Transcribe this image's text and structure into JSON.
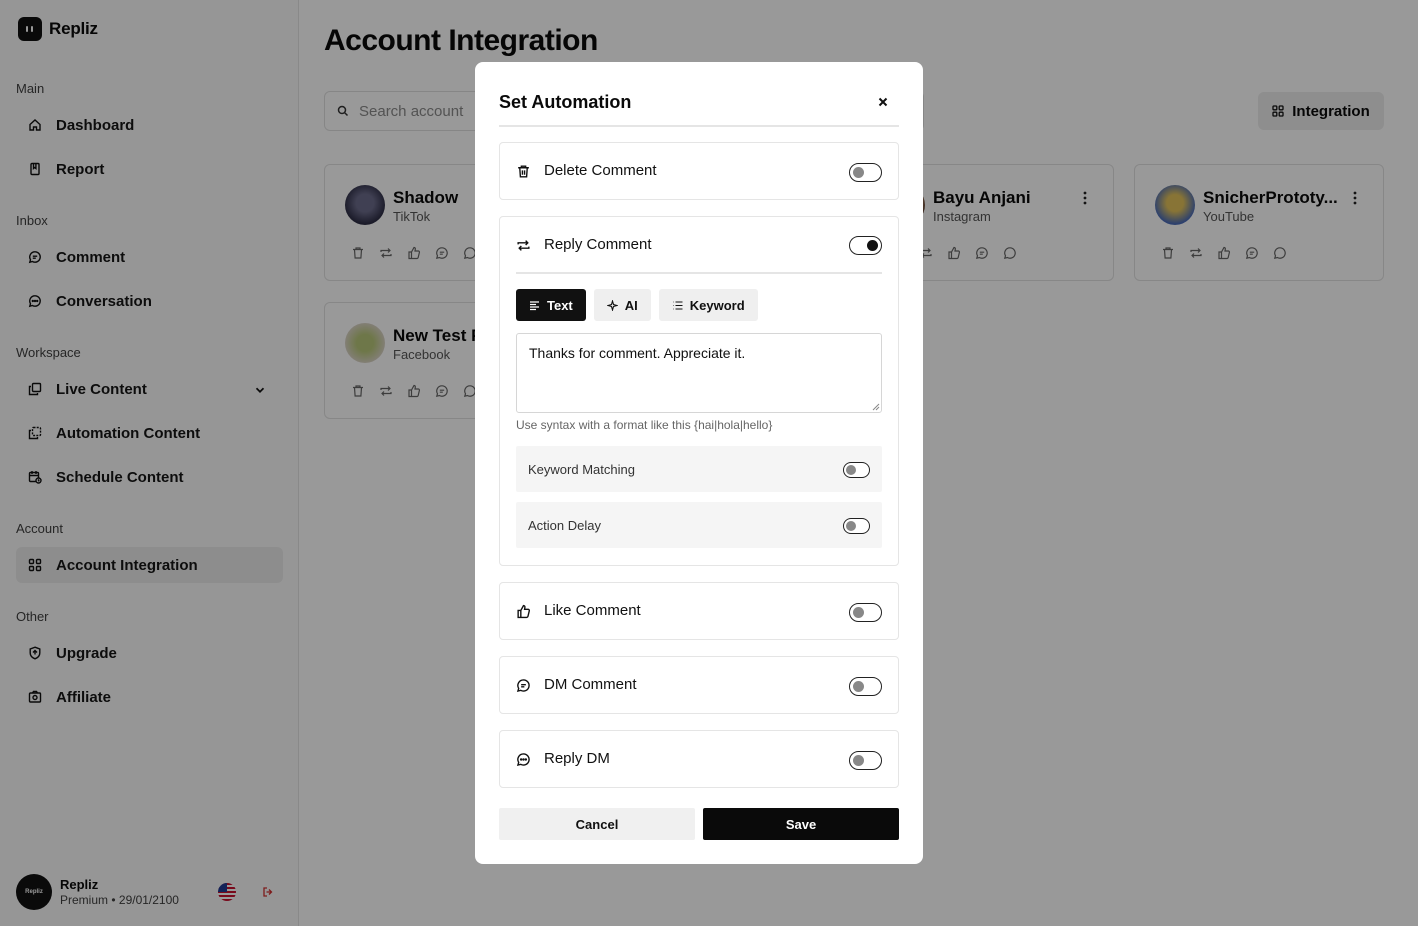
{
  "app": {
    "name": "Repliz"
  },
  "sidebar": {
    "sections": {
      "main": "Main",
      "inbox": "Inbox",
      "workspace": "Workspace",
      "account": "Account",
      "other": "Other"
    },
    "items": {
      "dashboard": "Dashboard",
      "report": "Report",
      "comment": "Comment",
      "conversation": "Conversation",
      "live_content": "Live Content",
      "automation_content": "Automation Content",
      "schedule_content": "Schedule Content",
      "account_integration": "Account Integration",
      "upgrade": "Upgrade",
      "affiliate": "Affiliate"
    },
    "active_item": "account_integration",
    "user": {
      "name": "Repliz",
      "plan": "Premium",
      "expiry": "29/01/2100",
      "avatar_text": "Repliz"
    }
  },
  "main": {
    "title": "Account Integration",
    "search_placeholder": "Search account",
    "integration_button": "Integration",
    "accounts": [
      {
        "name": "Shadow",
        "platform": "TikTok"
      },
      {
        "name": "Bayu Anjani",
        "platform": "Instagram"
      },
      {
        "name": "SnicherPrototy...",
        "platform": "YouTube"
      },
      {
        "name": "New Test P",
        "platform": "Facebook"
      }
    ]
  },
  "modal": {
    "title": "Set Automation",
    "sections": {
      "delete_comment": {
        "label": "Delete Comment",
        "enabled": false
      },
      "reply_comment": {
        "label": "Reply Comment",
        "enabled": true
      },
      "like_comment": {
        "label": "Like Comment",
        "enabled": false
      },
      "dm_comment": {
        "label": "DM Comment",
        "enabled": false
      },
      "reply_dm": {
        "label": "Reply DM",
        "enabled": false
      }
    },
    "reply": {
      "tabs": {
        "text": "Text",
        "ai": "AI",
        "keyword": "Keyword"
      },
      "active_tab": "Text",
      "text_value": "Thanks for comment. Appreciate it.",
      "hint": "Use syntax with a format like this {hai|hola|hello}",
      "keyword_matching": {
        "label": "Keyword Matching",
        "enabled": false
      },
      "action_delay": {
        "label": "Action Delay",
        "enabled": false
      }
    },
    "cancel": "Cancel",
    "save": "Save"
  },
  "colors": {
    "primary": "#0a0a0a",
    "overlay": "rgba(0,0,0,0.4)",
    "active_nav_bg": "#ebebeb"
  }
}
